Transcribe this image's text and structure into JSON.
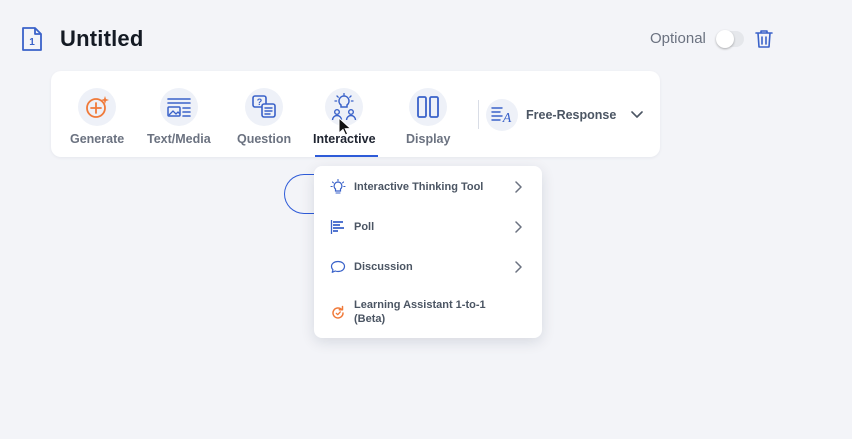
{
  "header": {
    "title": "Untitled",
    "page_number": "1",
    "optional_label": "Optional",
    "optional_enabled": false
  },
  "toolbar": {
    "tools": [
      {
        "label": "Generate",
        "icon": "sparkle-plus-icon",
        "active": false
      },
      {
        "label": "Text/Media",
        "icon": "text-media-icon",
        "active": false
      },
      {
        "label": "Question",
        "icon": "question-icon",
        "active": false
      },
      {
        "label": "Interactive",
        "icon": "lightbulb-people-icon",
        "active": true
      },
      {
        "label": "Display",
        "icon": "columns-icon",
        "active": false
      }
    ],
    "question_type": {
      "label": "Free-Response",
      "icon": "free-response-icon"
    }
  },
  "interactive_menu": {
    "items": [
      {
        "label": "Interactive Thinking Tool",
        "icon": "lightbulb-icon",
        "has_submenu": true
      },
      {
        "label": "Poll",
        "icon": "poll-bars-icon",
        "has_submenu": true
      },
      {
        "label": "Discussion",
        "icon": "chat-bubble-icon",
        "has_submenu": true
      },
      {
        "label": "Learning Assistant 1-to-1 (Beta)",
        "icon": "assistant-refresh-icon",
        "has_submenu": false
      }
    ]
  },
  "colors": {
    "accent": "#2e5bd8",
    "orange": "#f07a3a",
    "icon_blue": "#3a62c9",
    "background": "#f3f4f8"
  }
}
